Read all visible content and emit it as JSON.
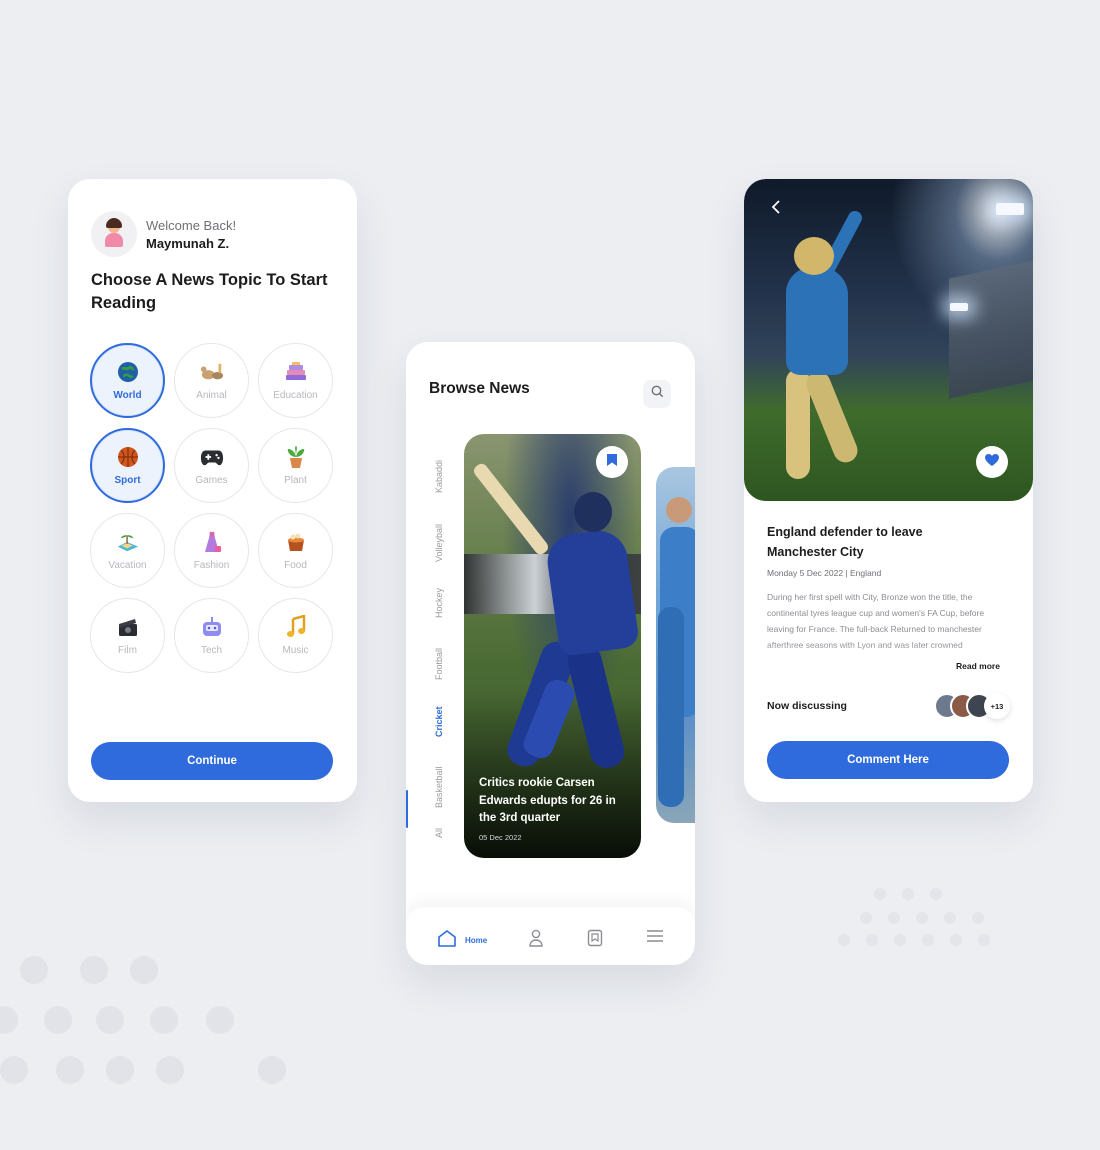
{
  "screen1": {
    "welcome": "Welcome Back!",
    "username": "Maymunah Z.",
    "title": "Choose A News Topic To Start Reading",
    "topics": [
      {
        "label": "World",
        "icon": "globe-icon",
        "selected": true
      },
      {
        "label": "Animal",
        "icon": "animal-icon",
        "selected": false
      },
      {
        "label": "Education",
        "icon": "books-icon",
        "selected": false
      },
      {
        "label": "Sport",
        "icon": "basketball-icon",
        "selected": true
      },
      {
        "label": "Games",
        "icon": "gamepad-icon",
        "selected": false
      },
      {
        "label": "Plant",
        "icon": "plant-icon",
        "selected": false
      },
      {
        "label": "Vacation",
        "icon": "island-icon",
        "selected": false
      },
      {
        "label": "Fashion",
        "icon": "dress-icon",
        "selected": false
      },
      {
        "label": "Food",
        "icon": "food-icon",
        "selected": false
      },
      {
        "label": "Film",
        "icon": "clapperboard-icon",
        "selected": false
      },
      {
        "label": "Tech",
        "icon": "robot-icon",
        "selected": false
      },
      {
        "label": "Music",
        "icon": "music-note-icon",
        "selected": false
      }
    ],
    "continue_label": "Continue"
  },
  "screen2": {
    "title": "Browse News",
    "categories": [
      "All",
      "Basketball",
      "Cricket",
      "Football",
      "Hockey",
      "Volleyball",
      "Kabaddi"
    ],
    "active_category": "Cricket",
    "card": {
      "title": "Critics rookie Carsen Edwards edupts for 26 in the 3rd quarter",
      "date": "05 Dec 2022"
    },
    "nav": {
      "home_label": "Home"
    }
  },
  "screen3": {
    "title": "England defender to leave Manchester City",
    "meta": "Monday 5 Dec 2022 | England",
    "body": "During her first spell with City, Bronze won the title, the continental tyres league cup and women's FA Cup, before leaving for France. The full-back Returned to manchester afterthree seasons with Lyon and was later crowned",
    "read_more": "Read more",
    "discussing_label": "Now discussing",
    "discussing_count": "+13",
    "comment_label": "Comment Here"
  },
  "colors": {
    "accent": "#2f6bdc",
    "background": "#eceef2",
    "card": "#ffffff"
  }
}
